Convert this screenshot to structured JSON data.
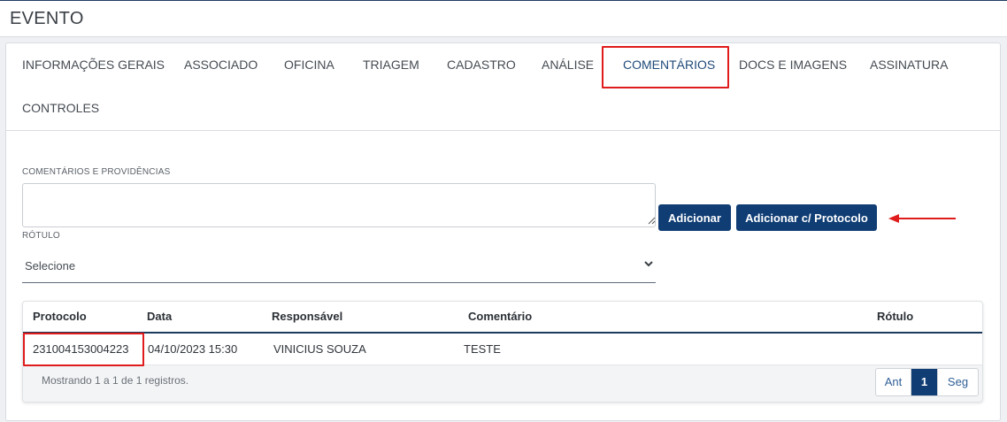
{
  "header": {
    "title": "EVENTO"
  },
  "tabs": [
    {
      "label": "INFORMAÇÕES GERAIS"
    },
    {
      "label": "ASSOCIADO"
    },
    {
      "label": "OFICINA"
    },
    {
      "label": "TRIAGEM"
    },
    {
      "label": "CADASTRO"
    },
    {
      "label": "ANÁLISE"
    },
    {
      "label": "COMENTÁRIOS",
      "active": true
    },
    {
      "label": "DOCS E IMAGENS"
    },
    {
      "label": "ASSINATURA"
    },
    {
      "label": "CONTROLES"
    }
  ],
  "form": {
    "comments_label": "COMENTÁRIOS E PROVIDÊNCIAS",
    "comments_value": "",
    "add_button": "Adicionar",
    "add_protocol_button": "Adicionar c/ Protocolo",
    "label_field": "RÓTULO",
    "label_select_value": "Selecione"
  },
  "table": {
    "columns": [
      "Protocolo",
      "Data",
      "Responsável",
      "Comentário",
      "Rótulo"
    ],
    "rows": [
      [
        "231004153004223",
        "04/10/2023 15:30",
        "VINICIUS SOUZA",
        "TESTE",
        ""
      ]
    ],
    "info": "Mostrando 1 a 1 de 1 registros.",
    "pager": {
      "prev": "Ant",
      "current": "1",
      "next": "Seg"
    }
  },
  "colors": {
    "primary": "#0f3d74",
    "highlight": "#e01b1b",
    "active_tab": "#1f4a7a"
  },
  "icons": {
    "select": "chevron-down-icon",
    "annotation": "arrow-left-icon",
    "textarea": "resize-grip-icon"
  }
}
